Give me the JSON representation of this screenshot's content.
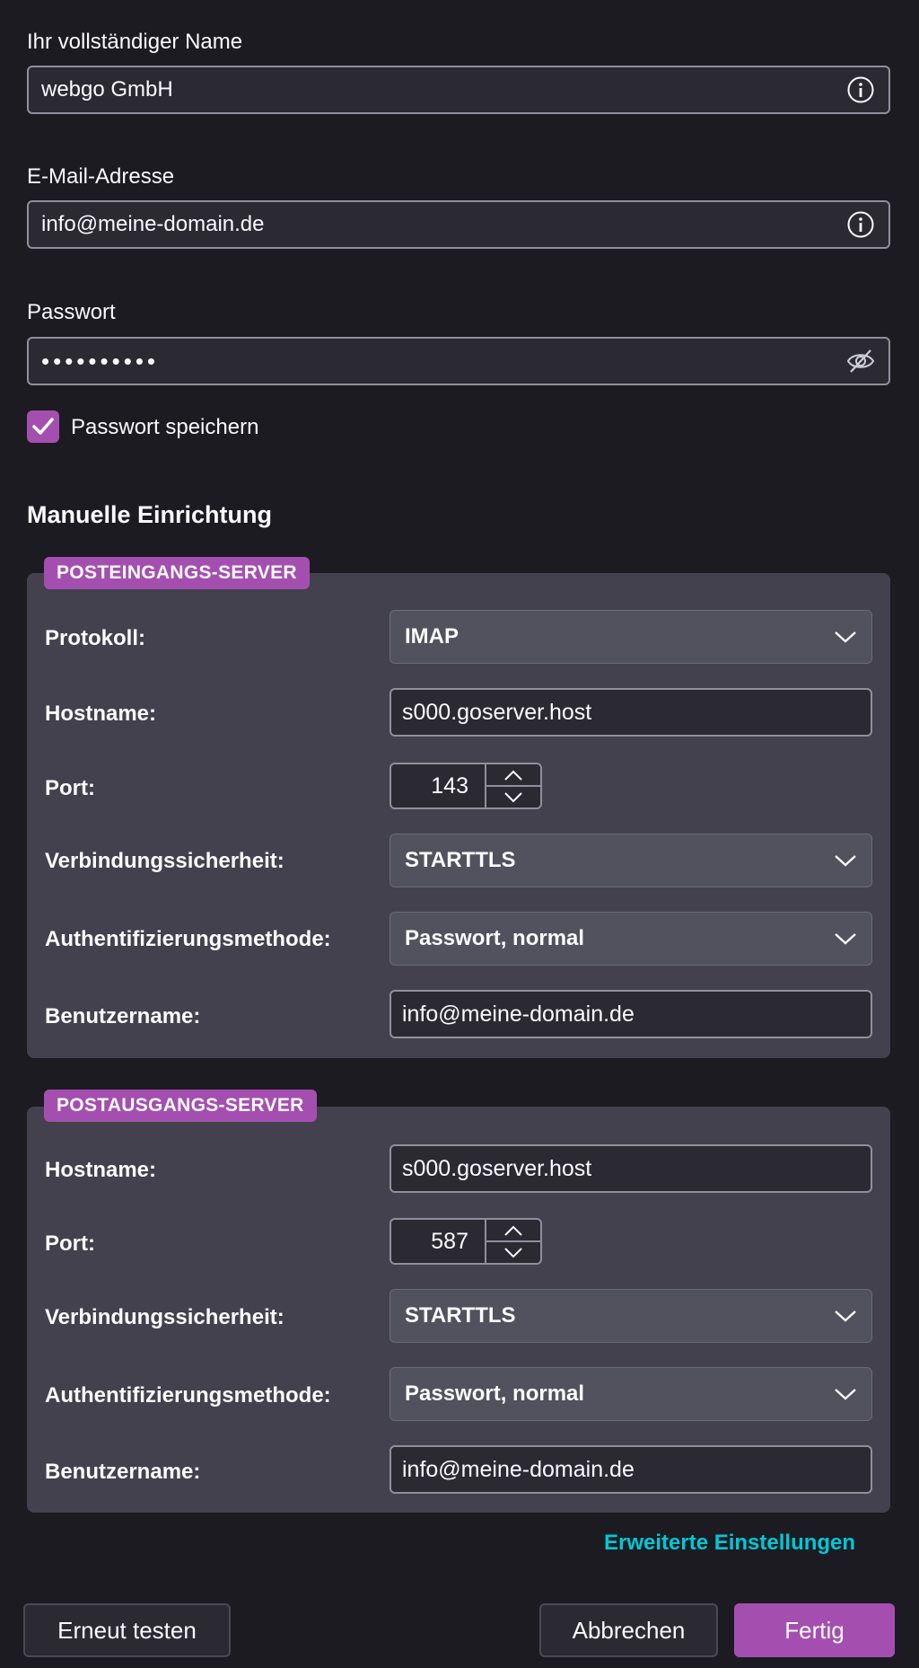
{
  "identity": {
    "name_label": "Ihr vollständiger Name",
    "name_value": "webgo GmbH",
    "email_label": "E-Mail-Adresse",
    "email_value": "info@meine-domain.de",
    "password_label": "Passwort",
    "password_value": "••••••••••",
    "remember_label": "Passwort speichern",
    "remember_checked": true
  },
  "manual": {
    "title": "Manuelle Einrichtung",
    "incoming": {
      "badge": "POSTEINGANGS-SERVER",
      "protocol_label": "Protokoll:",
      "protocol_value": "IMAP",
      "hostname_label": "Hostname:",
      "hostname_value": "s000.goserver.host",
      "port_label": "Port:",
      "port_value": "143",
      "security_label": "Verbindungssicherheit:",
      "security_value": "STARTTLS",
      "auth_label": "Authentifizierungsmethode:",
      "auth_value": "Passwort, normal",
      "username_label": "Benutzername:",
      "username_value": "info@meine-domain.de"
    },
    "outgoing": {
      "badge": "POSTAUSGANGS-SERVER",
      "hostname_label": "Hostname:",
      "hostname_value": "s000.goserver.host",
      "port_label": "Port:",
      "port_value": "587",
      "security_label": "Verbindungssicherheit:",
      "security_value": "STARTTLS",
      "auth_label": "Authentifizierungsmethode:",
      "auth_value": "Passwort, normal",
      "username_label": "Benutzername:",
      "username_value": "info@meine-domain.de"
    },
    "advanced_link": "Erweiterte Einstellungen"
  },
  "buttons": {
    "retest": "Erneut testen",
    "cancel": "Abbrechen",
    "done": "Fertig"
  },
  "colors": {
    "background": "#1c1b22",
    "panel": "#42414d",
    "accent": "#a44fb0",
    "link": "#00c8d7"
  },
  "icons": {
    "info": "info-circle-icon",
    "password_toggle": "eye-slash-icon",
    "check": "checkmark-icon",
    "dropdown": "chevron-down-icon",
    "spin_up": "chevron-up-icon",
    "spin_down": "chevron-down-icon"
  }
}
